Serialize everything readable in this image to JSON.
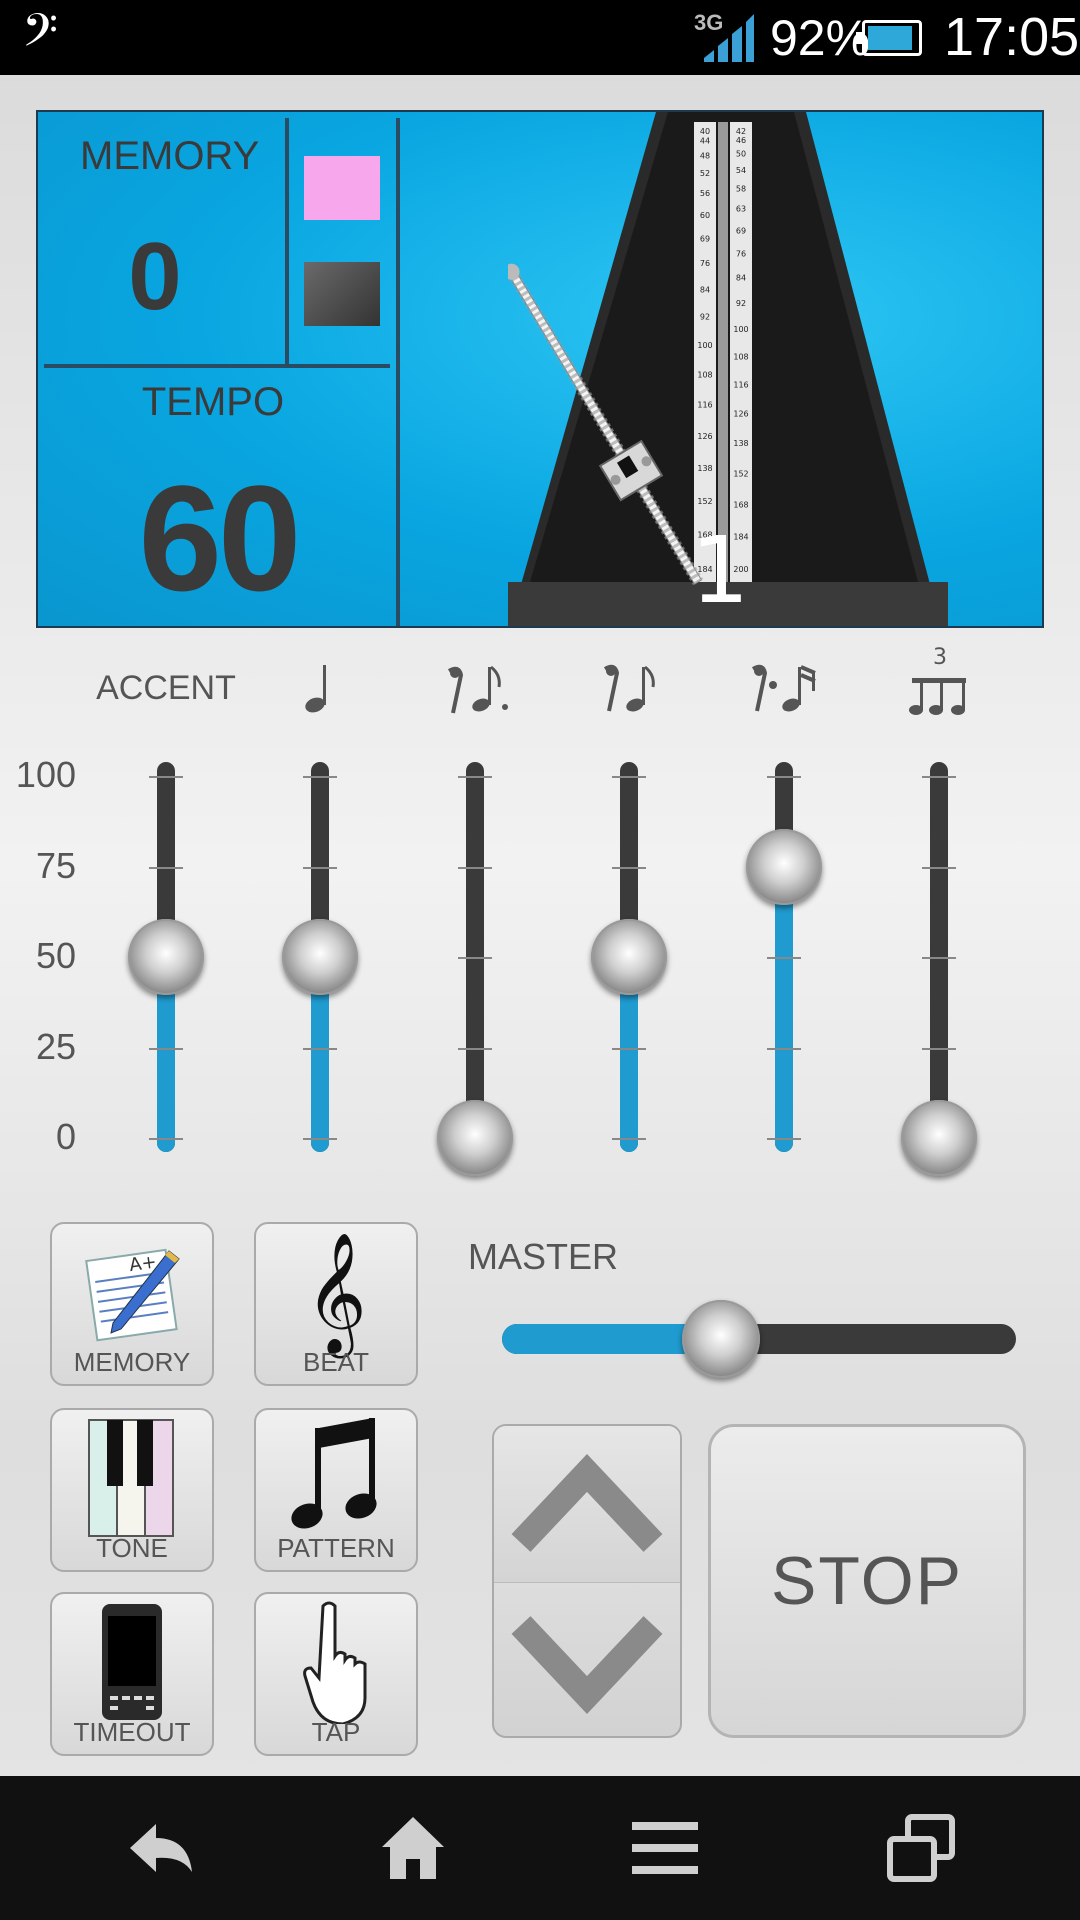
{
  "status_bar": {
    "app_icon": "bass-clef-icon",
    "network": "3G",
    "battery_percent": "92%",
    "battery_level": 0.92,
    "time": "17:05"
  },
  "display": {
    "memory_label": "MEMORY",
    "memory_value": "0",
    "tempo_label": "TEMPO",
    "tempo_value": "60",
    "swatch_colors": [
      "#f7a8ec",
      "#444444"
    ],
    "beat_number": "1",
    "scale_left": [
      "40",
      "44",
      "48",
      "52",
      "56",
      "60",
      "69",
      "76",
      "84",
      "92",
      "100",
      "108",
      "116",
      "126",
      "138",
      "152",
      "168",
      "184"
    ],
    "scale_right": [
      "42",
      "46",
      "50",
      "54",
      "58",
      "63",
      "69",
      "76",
      "84",
      "92",
      "100",
      "108",
      "116",
      "126",
      "138",
      "152",
      "168",
      "184",
      "200"
    ],
    "accent_color": "#09a6e1"
  },
  "mixer": {
    "scale_labels": [
      "100",
      "75",
      "50",
      "25",
      "0"
    ],
    "sliders": [
      {
        "head": "ACCENT",
        "icon": "accent-label",
        "value": 50
      },
      {
        "head": "",
        "icon": "quarter-note-icon",
        "value": 50
      },
      {
        "head": "",
        "icon": "dotted-eighth-note-icon",
        "value": 0
      },
      {
        "head": "",
        "icon": "eighth-note-icon",
        "value": 50
      },
      {
        "head": "",
        "icon": "sixteenth-note-icon",
        "value": 75
      },
      {
        "head": "",
        "icon": "triplet-icon",
        "value": 0
      }
    ],
    "triplet_number": "3"
  },
  "buttons": {
    "memory": "MEMORY",
    "beat": "BEAT",
    "tone": "TONE",
    "pattern": "PATTERN",
    "timeout": "TIMEOUT",
    "tap": "TAP"
  },
  "master": {
    "label": "MASTER",
    "value": 0.42
  },
  "transport": {
    "stop": "STOP"
  },
  "nav": {
    "icons": [
      "back-icon",
      "home-icon",
      "menu-icon",
      "recent-apps-icon"
    ]
  }
}
